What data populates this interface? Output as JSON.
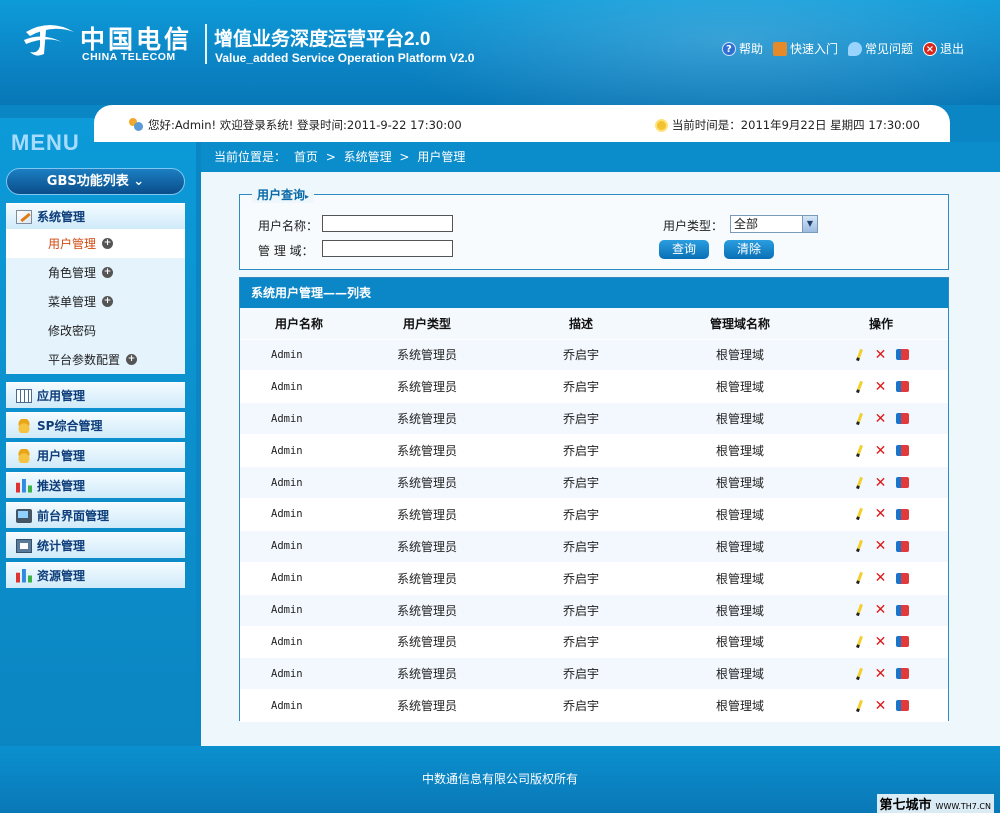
{
  "header": {
    "logo_cn": "中国电信",
    "logo_en": "CHINA TELECOM",
    "title": "增值业务深度运营平台2.0",
    "subtitle": "Value_added Service  Operation Platform V2.0",
    "links": {
      "help": "帮助",
      "quick_start": "快速入门",
      "faq": "常见问题",
      "logout": "退出"
    }
  },
  "infobar": {
    "welcome": "您好:Admin!  欢迎登录系统!  登录时间:2011-9-22  17:30:00",
    "current_time": "当前时间是：2011年9月22日 星期四 17:30:00"
  },
  "sidebar": {
    "menu_title": "MENU",
    "gbs_label": "GBS功能列表",
    "sections": [
      {
        "label": "系统管理",
        "icon": "settings-icon"
      },
      {
        "label": "应用管理",
        "icon": "apps-icon"
      },
      {
        "label": "SP综合管理",
        "icon": "coins-icon"
      },
      {
        "label": "用户管理",
        "icon": "coins-icon"
      },
      {
        "label": "推送管理",
        "icon": "bar-chart-icon"
      },
      {
        "label": "前台界面管理",
        "icon": "computer-icon"
      },
      {
        "label": "统计管理",
        "icon": "statistics-icon"
      },
      {
        "label": "资源管理",
        "icon": "bar-chart-icon"
      }
    ],
    "sub_items": [
      "用户管理",
      "角色管理",
      "菜单管理",
      "修改密码",
      "平台参数配置"
    ]
  },
  "breadcrumb": {
    "prefix": "当前位置是：",
    "items": [
      "首页",
      ">",
      "系统管理",
      ">",
      "用户管理"
    ]
  },
  "query": {
    "legend": "用户查询",
    "username_label": "用户名称：",
    "domain_label": "管 理 域：",
    "usertype_label": "用户类型：",
    "usertype_value": "全部",
    "username_value": "",
    "domain_value": "",
    "search_button": "查询",
    "clear_button": "清除"
  },
  "list": {
    "title": "系统用户管理——列表",
    "columns": [
      "用户名称",
      "用户类型",
      "描述",
      "管理域名称",
      "操作"
    ],
    "rows": [
      [
        "Admin",
        "系统管理员",
        "乔启宇",
        "根管理域"
      ],
      [
        "Admin",
        "系统管理员",
        "乔启宇",
        "根管理域"
      ],
      [
        "Admin",
        "系统管理员",
        "乔启宇",
        "根管理域"
      ],
      [
        "Admin",
        "系统管理员",
        "乔启宇",
        "根管理域"
      ],
      [
        "Admin",
        "系统管理员",
        "乔启宇",
        "根管理域"
      ],
      [
        "Admin",
        "系统管理员",
        "乔启宇",
        "根管理域"
      ],
      [
        "Admin",
        "系统管理员",
        "乔启宇",
        "根管理域"
      ],
      [
        "Admin",
        "系统管理员",
        "乔启宇",
        "根管理域"
      ],
      [
        "Admin",
        "系统管理员",
        "乔启宇",
        "根管理域"
      ],
      [
        "Admin",
        "系统管理员",
        "乔启宇",
        "根管理域"
      ],
      [
        "Admin",
        "系统管理员",
        "乔启宇",
        "根管理域"
      ],
      [
        "Admin",
        "系统管理员",
        "乔启宇",
        "根管理域"
      ]
    ],
    "row_actions": [
      "edit-icon",
      "delete-icon",
      "assign-icon"
    ]
  },
  "footer": {
    "copyright": "中数通信息有限公司版权所有",
    "watermark": "第七城市",
    "watermark_url": "WWW.TH7.CN"
  },
  "colors": {
    "brand_blue": "#0b86c7",
    "active_item": "#d04a0f",
    "delete_red": "#e01a1a"
  }
}
